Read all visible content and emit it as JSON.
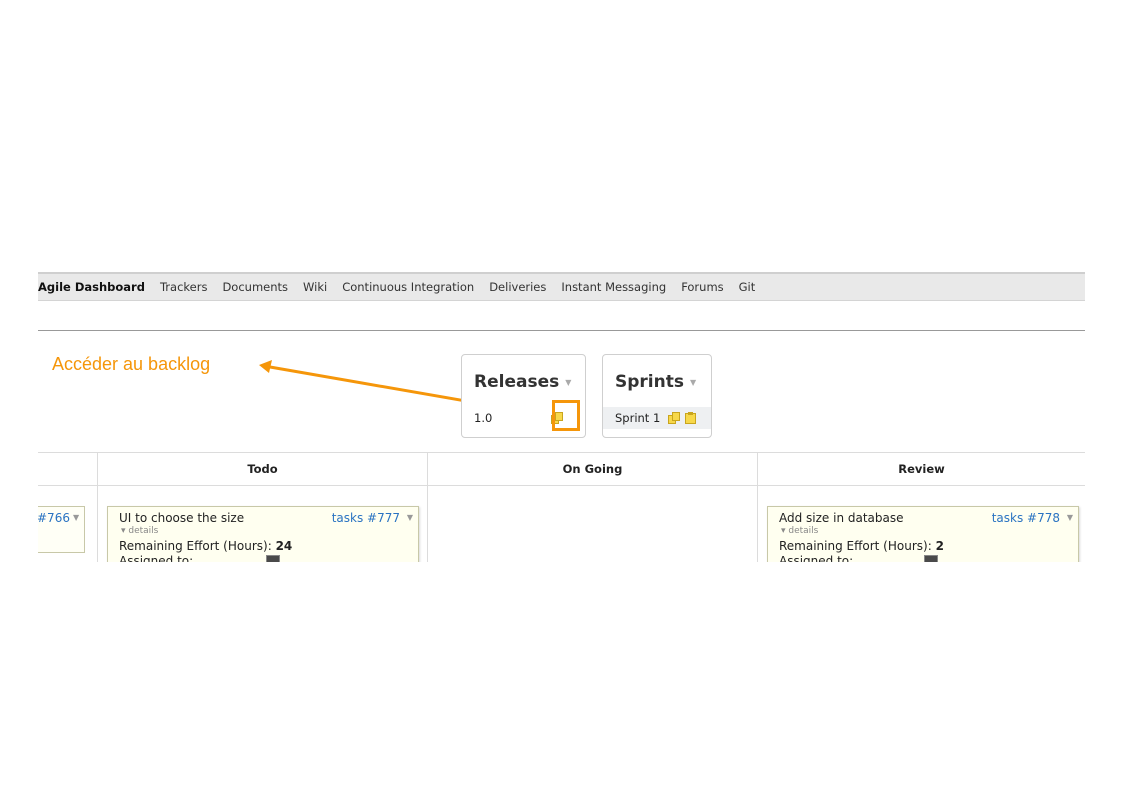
{
  "nav": {
    "items": [
      {
        "label": "Agile Dashboard",
        "active": true
      },
      {
        "label": "Trackers"
      },
      {
        "label": "Documents"
      },
      {
        "label": "Wiki"
      },
      {
        "label": "Continuous Integration"
      },
      {
        "label": "Deliveries"
      },
      {
        "label": "Instant Messaging"
      },
      {
        "label": "Forums"
      },
      {
        "label": "Git"
      }
    ]
  },
  "annotation": {
    "text": "Accéder au backlog",
    "color": "#f5960a"
  },
  "releases": {
    "title": "Releases",
    "item": "1.0",
    "icon": "backlog-icon"
  },
  "sprints": {
    "title": "Sprints",
    "item": "Sprint 1",
    "icons": [
      "backlog-icon",
      "note-icon"
    ]
  },
  "board": {
    "columns": [
      "Todo",
      "On Going",
      "Review"
    ],
    "cards": [
      {
        "ref": "#766",
        "partial": true
      },
      {
        "title": "UI to choose the size",
        "ref": "tasks #777",
        "details": "details",
        "effort_label": "Remaining Effort (Hours):",
        "effort": "24",
        "assigned": "Assigned to:"
      },
      {
        "title": "Add size in database",
        "ref": "tasks #778",
        "details": "details",
        "effort_label": "Remaining Effort (Hours):",
        "effort": "2",
        "assigned": "Assigned to:"
      }
    ]
  },
  "colors": {
    "accent": "#f5960a",
    "link": "#2a73c2",
    "card_bg": "#fffff0",
    "nav_bg": "#e9e9e9"
  }
}
